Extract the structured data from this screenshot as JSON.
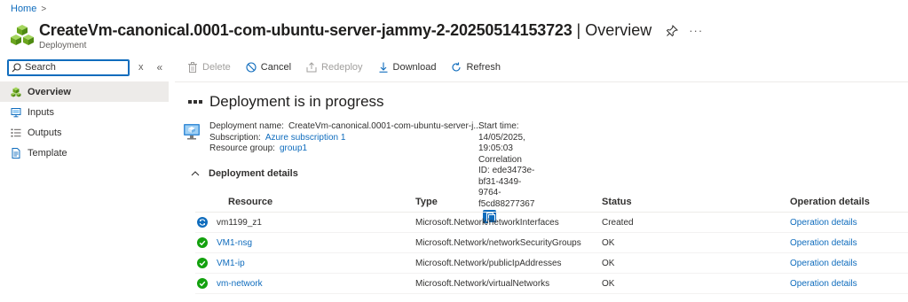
{
  "breadcrumb": {
    "home": "Home",
    "separator": ">"
  },
  "header": {
    "title": "CreateVm-canonical.0001-com-ubuntu-server-jammy-2-20250514153723",
    "separator": "|",
    "section": "Overview",
    "subtitle": "Deployment",
    "more": "···"
  },
  "nav": {
    "search_placeholder": "Search",
    "clear": "x",
    "collapse": "«",
    "items": [
      {
        "label": "Overview",
        "icon": "overview-icon"
      },
      {
        "label": "Inputs",
        "icon": "inputs-icon"
      },
      {
        "label": "Outputs",
        "icon": "outputs-icon"
      },
      {
        "label": "Template",
        "icon": "template-icon"
      }
    ]
  },
  "toolbar": {
    "delete": "Delete",
    "cancel": "Cancel",
    "redeploy": "Redeploy",
    "download": "Download",
    "refresh": "Refresh"
  },
  "status": {
    "text": "Deployment is in progress"
  },
  "essentials": {
    "deployment_name_label": "Deployment name:",
    "deployment_name": "CreateVm-canonical.0001-com-ubuntu-server-j...",
    "subscription_label": "Subscription:",
    "subscription": "Azure subscription 1",
    "resource_group_label": "Resource group:",
    "resource_group": "group1",
    "start_time_label": "Start time:",
    "start_time": "14/05/2025, 19:05:03",
    "correlation_label": "Correlation ID:",
    "correlation_id": "ede3473e-bf31-4349-9764-f5cd88277367"
  },
  "details": {
    "heading": "Deployment details",
    "columns": {
      "resource": "Resource",
      "type": "Type",
      "status": "Status",
      "operation": "Operation details"
    },
    "rows": [
      {
        "resource": "vm1199_z1",
        "type": "Microsoft.Network/networkInterfaces",
        "status": "Created",
        "operation": "Operation details",
        "state": "running"
      },
      {
        "resource": "VM1-nsg",
        "type": "Microsoft.Network/networkSecurityGroups",
        "status": "OK",
        "operation": "Operation details",
        "state": "ok"
      },
      {
        "resource": "VM1-ip",
        "type": "Microsoft.Network/publicIpAddresses",
        "status": "OK",
        "operation": "Operation details",
        "state": "ok"
      },
      {
        "resource": "vm-network",
        "type": "Microsoft.Network/virtualNetworks",
        "status": "OK",
        "operation": "Operation details",
        "state": "ok"
      }
    ]
  },
  "colors": {
    "accent": "#0f6cbd",
    "success": "#13a10e",
    "running": "#0f6cbd",
    "disabled": "#a19f9d"
  }
}
